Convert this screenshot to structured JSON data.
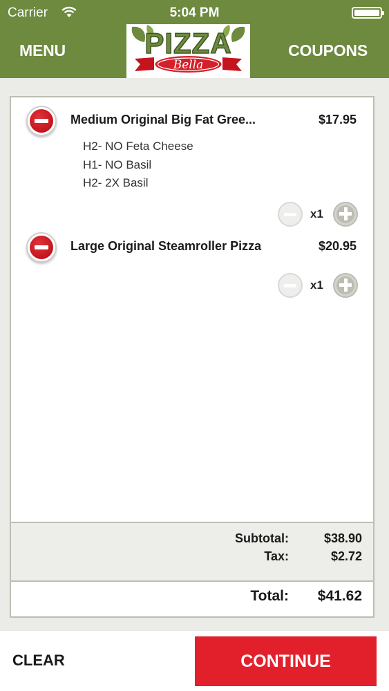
{
  "status_bar": {
    "carrier": "Carrier",
    "time": "5:04 PM"
  },
  "header": {
    "menu_label": "MENU",
    "coupons_label": "COUPONS",
    "logo": {
      "word": "PIZZA",
      "script": "Bella"
    }
  },
  "cart": {
    "items": [
      {
        "name": "Medium Original  Big Fat Gree...",
        "price": "$17.95",
        "modifiers": [
          "H2- NO Feta Cheese",
          "H1- NO Basil",
          "H2- 2X Basil"
        ],
        "quantity": "x1"
      },
      {
        "name": "Large Original  Steamroller Pizza",
        "price": "$20.95",
        "modifiers": [],
        "quantity": "x1"
      }
    ],
    "subtotal_label": "Subtotal:",
    "subtotal_value": "$38.90",
    "tax_label": "Tax:",
    "tax_value": "$2.72",
    "total_label": "Total:",
    "total_value": "$41.62"
  },
  "footer": {
    "clear_label": "CLEAR",
    "continue_label": "CONTINUE"
  },
  "colors": {
    "header_green": "#6d8a3f",
    "continue_red": "#e2202c",
    "remove_red": "#c5141d"
  }
}
